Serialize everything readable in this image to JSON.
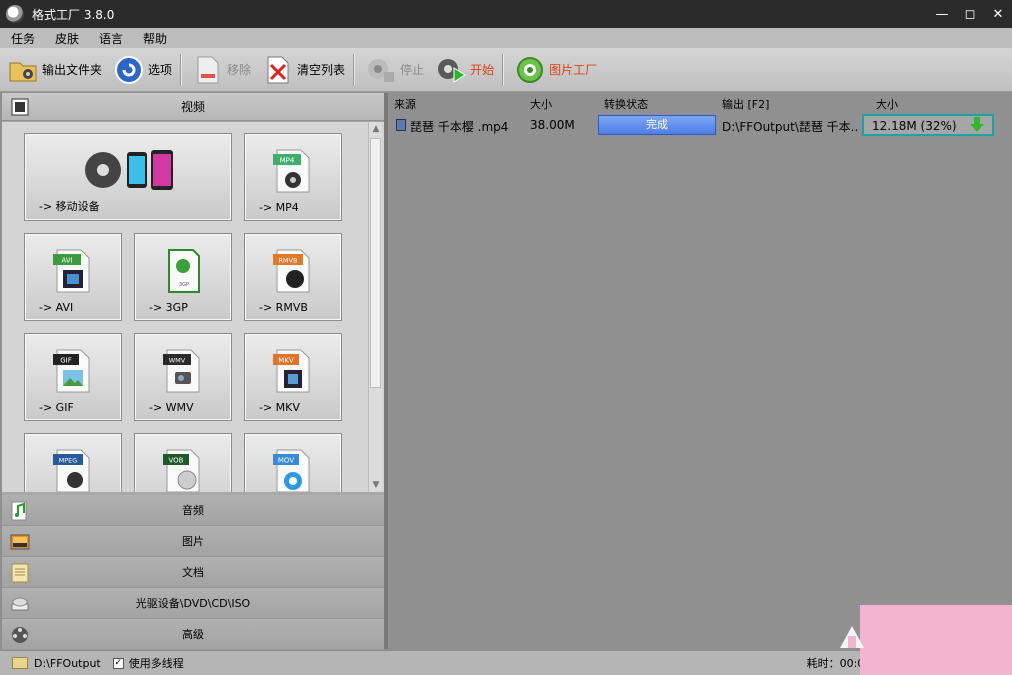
{
  "window": {
    "title": "格式工厂 3.8.0"
  },
  "menu": [
    "任务",
    "皮肤",
    "语言",
    "帮助"
  ],
  "toolbar": {
    "output_folder": "输出文件夹",
    "options": "选项",
    "remove": "移除",
    "clear_list": "清空列表",
    "stop": "停止",
    "start": "开始",
    "picture_factory": "图片工厂"
  },
  "left": {
    "video_header": "视频",
    "tiles": [
      {
        "label": "-> 移动设备",
        "badge": ""
      },
      {
        "label": "-> MP4",
        "badge": "MP4"
      },
      {
        "label": "-> AVI",
        "badge": "AVI"
      },
      {
        "label": "-> 3GP",
        "badge": "3GP"
      },
      {
        "label": "-> RMVB",
        "badge": "RMVB"
      },
      {
        "label": "-> GIF",
        "badge": "GIF"
      },
      {
        "label": "-> WMV",
        "badge": "WMV"
      },
      {
        "label": "-> MKV",
        "badge": "MKV"
      },
      {
        "label": "",
        "badge": "MPEG"
      },
      {
        "label": "",
        "badge": "VOB"
      },
      {
        "label": "",
        "badge": "MOV"
      }
    ],
    "categories": [
      "音频",
      "图片",
      "文档",
      "光驱设备\\DVD\\CD\\ISO",
      "高级"
    ]
  },
  "list": {
    "headers": {
      "source": "来源",
      "size": "大小",
      "status": "转换状态",
      "output": "输出 [F2]",
      "out_size": "大小"
    },
    "rows": [
      {
        "source": "琵琶 千本樱 .mp4",
        "size": "38.00M",
        "status": "完成",
        "output": "D:\\FFOutput\\琵琶 千本...",
        "out_size": "12.18M  (32%)"
      }
    ]
  },
  "status": {
    "path": "D:\\FFOutput",
    "multithread": "使用多线程",
    "elapsed": "耗时：00:00:3"
  },
  "colors": {
    "status_done": "#4f7ee8",
    "highlight_border": "#1ca3a3",
    "accent": "#e04010"
  }
}
